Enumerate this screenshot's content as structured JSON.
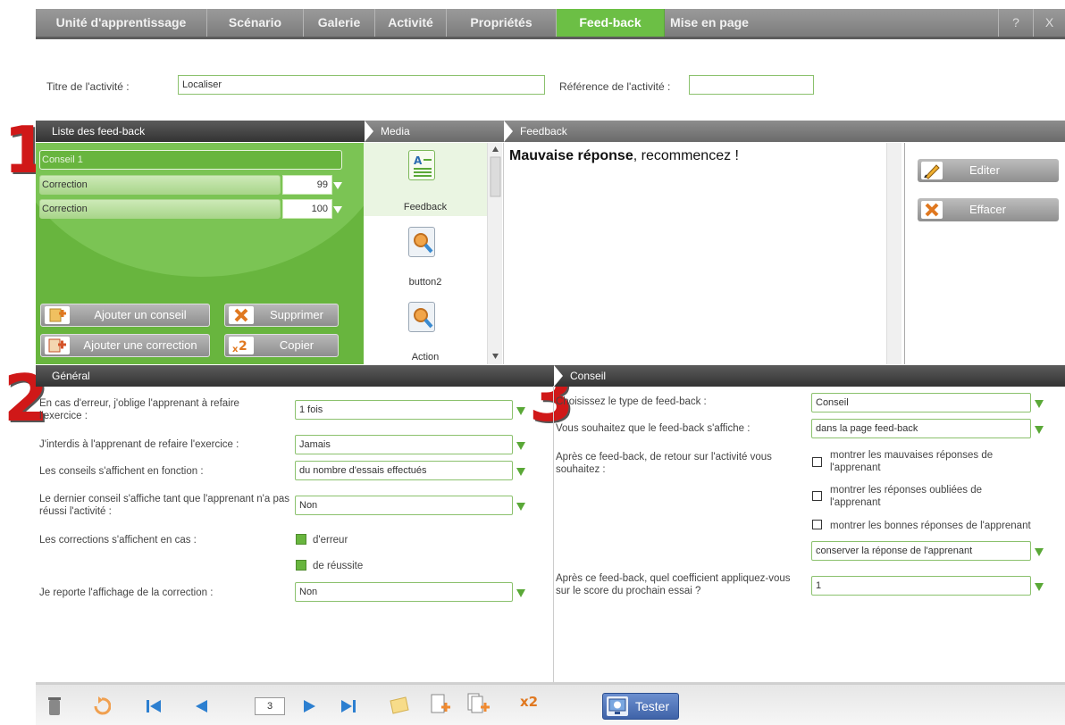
{
  "tabs": [
    "Unité d'apprentissage",
    "Scénario",
    "Galerie",
    "Activité",
    "Propriétés",
    "Feed-back",
    "Mise en page"
  ],
  "tab_help": "?",
  "tab_close": "X",
  "title_row": {
    "title_label": "Titre de l'activité :",
    "title_value": "Localiser",
    "ref_label": "Référence de l'activité :",
    "ref_value": ""
  },
  "markers": [
    "1",
    "2",
    "3"
  ],
  "headers": {
    "list": "Liste des feed-back",
    "media": "Media",
    "feedback": "Feedback",
    "general": "Général",
    "conseil": "Conseil"
  },
  "fb_list": [
    {
      "label": "Conseil 1",
      "num": ""
    },
    {
      "label": "Correction",
      "num": "99"
    },
    {
      "label": "Correction",
      "num": "100"
    }
  ],
  "list_buttons": {
    "add_hint": "Ajouter un conseil",
    "delete": "Supprimer",
    "add_correction": "Ajouter une correction",
    "copy": "Copier"
  },
  "media_items": [
    "Feedback",
    "button2",
    "Action"
  ],
  "feedback_text": {
    "bold": "Mauvaise réponse",
    "rest": ", recommencez !"
  },
  "right_buttons": {
    "edit": "Editer",
    "erase": "Effacer"
  },
  "general": {
    "q1_label": "En cas d'erreur, j'oblige l'apprenant à refaire l'exercice :",
    "q1_value": "1 fois",
    "q2_label": "J'interdis à l'apprenant de refaire l'exercice :",
    "q2_value": "Jamais",
    "q3_label": "Les conseils s'affichent en fonction :",
    "q3_value": "du nombre d'essais effectués",
    "q4_label": "Le dernier conseil s'affiche tant que l'apprenant n'a pas réussi l'activité :",
    "q4_value": "Non",
    "q5_label": "Les corrections s'affichent en cas :",
    "q5_opt1": "d'erreur",
    "q5_opt2": "de réussite",
    "q6_label": "Je reporte l'affichage de la correction :",
    "q6_value": "Non"
  },
  "conseil": {
    "c1_label": "Choisissez le type de feed-back :",
    "c1_value": "Conseil",
    "c2_label": "Vous souhaitez que le feed-back s'affiche :",
    "c2_value": "dans la page feed-back",
    "c3_label": "Après ce feed-back, de retour sur l'activité vous souhaitez :",
    "c3_opt1": "montrer les mauvaises réponses de l'apprenant",
    "c3_opt2": "montrer les réponses oubliées de l'apprenant",
    "c3_opt3": "montrer les bonnes réponses de l'apprenant",
    "c3_select": "conserver la réponse de l'apprenant",
    "c4_label": "Après ce feed-back, quel coefficient appliquez-vous sur le score du prochain essai ?",
    "c4_value": "1"
  },
  "bottom": {
    "page": "3",
    "tester": "Tester",
    "x2": "x2"
  },
  "colors": {
    "accent_green": "#68b53e",
    "marker_red": "#d01818",
    "tester_blue": "#3f63a8"
  }
}
